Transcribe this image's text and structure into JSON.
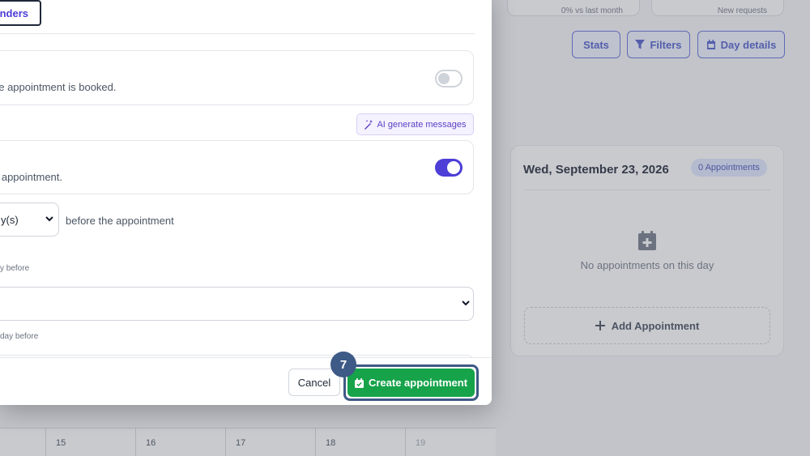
{
  "background": {
    "stat_cards": [
      {
        "text": "0% vs last month"
      },
      {
        "text": "New requests"
      }
    ],
    "toolbar": {
      "stats_label": "Stats",
      "filters_label": "Filters",
      "day_details_label": "Day details",
      "accent_color": "#4451c9"
    },
    "day_panel": {
      "date": "Wed, September 23, 2026",
      "badge": "0 Appointments",
      "empty_text": "No appointments on this day",
      "add_label": "Add Appointment"
    },
    "calendar": {
      "days": [
        "15",
        "16",
        "17",
        "18",
        "19"
      ]
    }
  },
  "modal": {
    "tab_label": "Reminders",
    "tab_visible_text": "inders",
    "booking_card": {
      "text": "he appointment is booked.",
      "toggle_on": false
    },
    "ai_button_label": "AI generate messages",
    "reminder_card": {
      "text": "e appointment.",
      "toggle_on": true,
      "toggle_color": "#4c3ed6"
    },
    "timing": {
      "unit_value": "y(s)",
      "after_text": "before the appointment",
      "hint_1": "y before",
      "hint_2": "day before"
    },
    "footer": {
      "cancel_label": "Cancel",
      "create_label": "Create appointment",
      "create_color": "#16a34a"
    },
    "step_badge": "7"
  }
}
